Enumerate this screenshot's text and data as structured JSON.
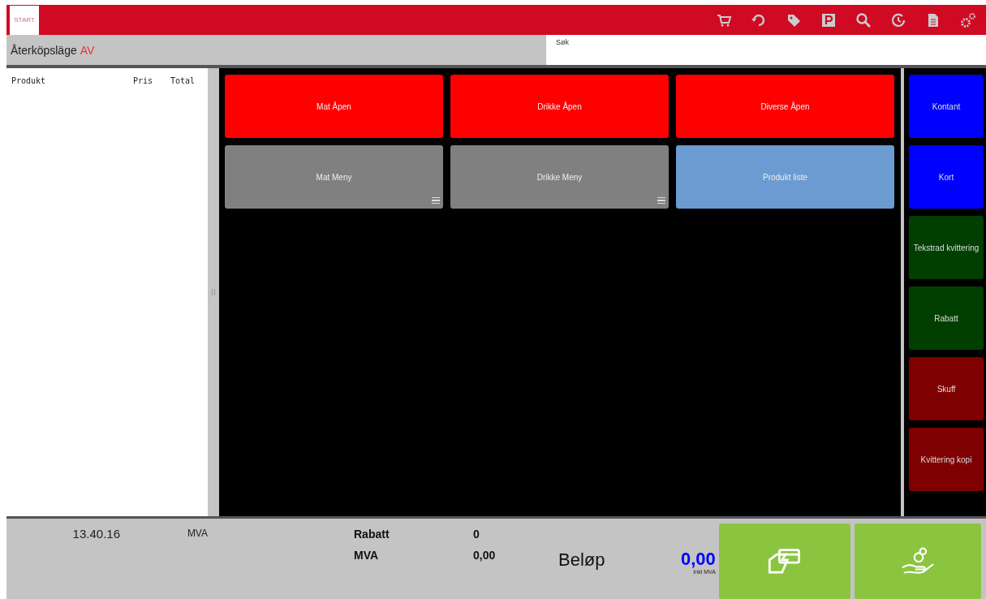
{
  "header": {
    "logo": "START"
  },
  "mode_bar": {
    "label": "Återköpsläge",
    "state": "AV"
  },
  "search": {
    "placeholder": "Søk"
  },
  "order_table": {
    "columns": [
      "Produkt",
      "Pris",
      "Total"
    ]
  },
  "product_buttons": [
    {
      "label": "Mat Åpen",
      "color": "#ff0000",
      "menu": false
    },
    {
      "label": "Drikke Åpen",
      "color": "#ff0000",
      "menu": false
    },
    {
      "label": "Diverse Åpen",
      "color": "#ff0000",
      "menu": false
    },
    {
      "label": "Mat Meny",
      "color": "#808080",
      "menu": true
    },
    {
      "label": "Drikke Meny",
      "color": "#808080",
      "menu": true
    },
    {
      "label": "Produkt liste",
      "color": "#6b9bd1",
      "menu": false
    }
  ],
  "function_buttons": [
    {
      "label": "Kontant",
      "color": "#0000ff"
    },
    {
      "label": "Kort",
      "color": "#0000ff"
    },
    {
      "label": "Tekstrad kvittering",
      "color": "#003f00"
    },
    {
      "label": "Rabatt",
      "color": "#003f00"
    },
    {
      "label": "Skuff",
      "color": "#7f0000"
    },
    {
      "label": "Kvittering kopi",
      "color": "#7f0000"
    }
  ],
  "footer": {
    "time": "13.40.16",
    "tax_label": "MVA",
    "summary": [
      {
        "label": "Rabatt",
        "value": "0"
      },
      {
        "label": "MVA",
        "value": "0,00"
      }
    ],
    "amount_label": "Beløp",
    "amount": "0,00",
    "amount_note": "Inkl MVA"
  }
}
